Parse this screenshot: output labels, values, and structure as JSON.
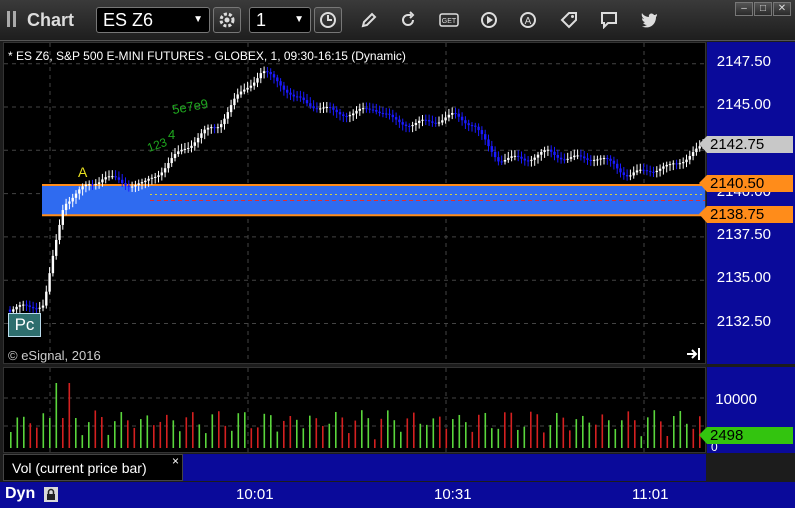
{
  "window": {
    "title": "Chart",
    "minimize_glyph": "–",
    "maximize_glyph": "□",
    "close_glyph": "✕"
  },
  "toolbar": {
    "symbol": "ES Z6",
    "interval": "1",
    "icons": [
      "settings-icon",
      "clock-icon",
      "draw-icon",
      "refresh-icon",
      "get-icon",
      "play-icon",
      "alert-icon",
      "tag-icon",
      "comment-icon",
      "twitter-icon"
    ]
  },
  "chart": {
    "title": "* ES Z6, S&P 500 E-MINI FUTURES - GLOBEX, 1, 09:30-16:15 (Dynamic)",
    "copyright": "© eSignal, 2016",
    "pc_label": "Pc",
    "annotation_a": "A",
    "annotation_123": "123",
    "annotation_4": "4",
    "annotation_5e7e9": "5e7e9",
    "price_ticks": [
      "2147.50",
      "2145.00",
      "2142.50",
      "2140.00",
      "2137.50",
      "2135.00",
      "2132.50"
    ],
    "last_price_tag": "2142.75",
    "upper_level_tag": "2140.50",
    "lower_level_tag": "2138.75",
    "colors": {
      "background": "#000000",
      "axis": "#0a0a9a",
      "up_candle": "#ffffff",
      "down_candle": "#1a1aff",
      "zone": "#2f6bf0",
      "level_line": "#ff8c1a",
      "vol_up": "#5ad63c",
      "vol_down": "#d42020",
      "vol_tag": "#33c40f"
    }
  },
  "volume": {
    "label": "Vol (current price bar)",
    "close_glyph": "×",
    "ticks": [
      "10000",
      "0"
    ],
    "last_volume_tag": "2498"
  },
  "time_axis": {
    "dyn_label": "Dyn",
    "ticks": [
      "10:01",
      "10:31",
      "11:01"
    ]
  }
}
